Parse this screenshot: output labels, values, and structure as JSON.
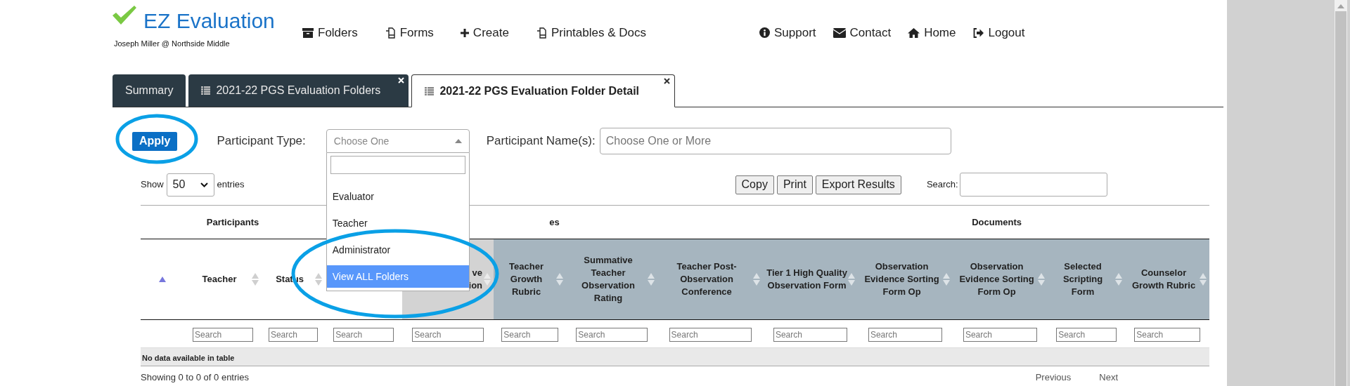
{
  "app": {
    "title": "EZ Evaluation",
    "user": "Joseph Miller @ Northside Middle"
  },
  "nav_left": [
    "Folders",
    "Forms",
    "Create",
    "Printables & Docs"
  ],
  "nav_right": [
    "Support",
    "Contact",
    "Home",
    "Logout"
  ],
  "tabs": [
    {
      "label": "Summary",
      "selected": false,
      "closable": false,
      "list_icon": false
    },
    {
      "label": "2021-22 PGS Evaluation Folders",
      "selected": false,
      "closable": true,
      "list_icon": true
    },
    {
      "label": "2021-22 PGS Evaluation Folder Detail",
      "selected": true,
      "closable": true,
      "list_icon": true
    }
  ],
  "filters": {
    "apply": "Apply",
    "participant_type": {
      "label": "Participant Type:",
      "placeholder": "Choose One",
      "expanded": true,
      "options": [
        {
          "label": "Evaluator",
          "selected": false
        },
        {
          "label": "Teacher",
          "selected": false
        },
        {
          "label": "Administrator",
          "selected": false
        },
        {
          "label": "View ALL Folders",
          "selected": true
        }
      ]
    },
    "participant_names": {
      "label": "Participant Name(s):",
      "placeholder": "Choose One or More"
    }
  },
  "length": {
    "show": "Show",
    "value": "50",
    "entries": "entries"
  },
  "buttons": [
    "Copy",
    "Print",
    "Export Results"
  ],
  "search": {
    "label": "Search:"
  },
  "table": {
    "groups": [
      {
        "label": "Participants"
      },
      {
        "label": "es"
      },
      {
        "label": "Documents"
      }
    ],
    "columns": [
      {
        "sorted": true,
        "kind": "plain"
      },
      {
        "label": "Teacher",
        "sorted": false,
        "kind": "plain",
        "placeholder": "Search"
      },
      {
        "label": "Status",
        "sorted": false,
        "kind": "plain",
        "placeholder": "Search"
      },
      {
        "sorted": false,
        "kind": "plain",
        "placeholder": "Search"
      },
      {
        "label": "ve\nion",
        "sorted": false,
        "kind": "highlighted",
        "placeholder": "Search"
      },
      {
        "label": "Teacher Growth Rubric",
        "sorted": false,
        "kind": "document",
        "placeholder": "Search"
      },
      {
        "label": "Summative Teacher Observation Rating",
        "sorted": false,
        "kind": "document",
        "placeholder": "Search"
      },
      {
        "label": "Teacher Post-Observation Conference",
        "sorted": false,
        "kind": "document",
        "placeholder": "Search"
      },
      {
        "label": "Tier 1 High Quality Observation Form",
        "sorted": false,
        "kind": "document",
        "placeholder": "Search"
      },
      {
        "label": "Observation Evidence Sorting Form Op",
        "sorted": false,
        "kind": "document",
        "placeholder": "Search"
      },
      {
        "label": "Observation Evidence Sorting Form Op",
        "sorted": false,
        "kind": "document",
        "placeholder": "Search"
      },
      {
        "label": "Selected Scripting Form",
        "sorted": false,
        "kind": "document",
        "placeholder": "Search"
      },
      {
        "label": "Counselor Growth Rubric",
        "sorted": false,
        "kind": "document",
        "placeholder": "Search"
      }
    ],
    "empty": "No data available in table"
  },
  "info": "Showing 0 to 0 of 0 entries",
  "pager": [
    "Previous",
    "Next"
  ]
}
